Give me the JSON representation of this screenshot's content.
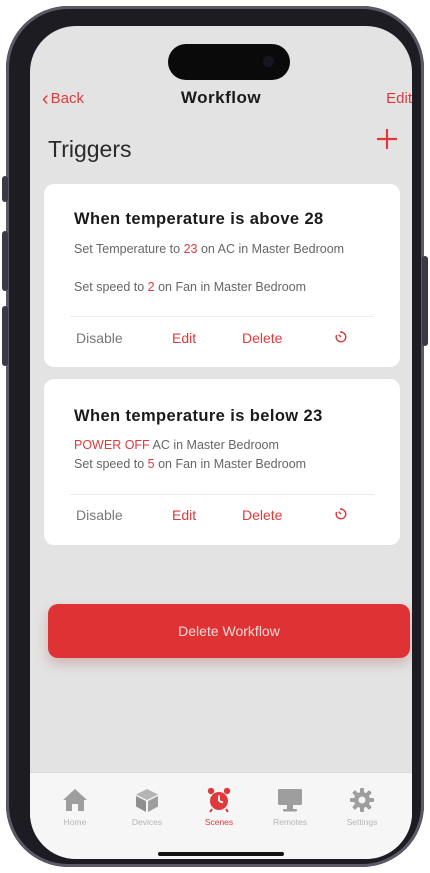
{
  "nav": {
    "back_label": "Back",
    "title": "Workflow",
    "edit_label": "Edit"
  },
  "triggers": {
    "heading": "Triggers",
    "add_icon": "plus-icon"
  },
  "cards": [
    {
      "title": "When temperature is above 28",
      "lines": [
        {
          "pre": "Set Temperature to ",
          "value": "23",
          "post": " on AC in Master Bedroom"
        },
        {
          "pre": "Set speed to ",
          "value": "2",
          "post": " on Fan in Master Bedroom"
        }
      ],
      "actions": {
        "disable": "Disable",
        "edit": "Edit",
        "delete": "Delete",
        "timer_icon": "timer-icon"
      }
    },
    {
      "title": "When temperature is below 23",
      "lines": [
        {
          "pre": "",
          "value": "POWER OFF",
          "post": " AC in Master Bedroom"
        },
        {
          "pre": "Set speed to ",
          "value": "5",
          "post": " on Fan in Master Bedroom"
        }
      ],
      "actions": {
        "disable": "Disable",
        "edit": "Edit",
        "delete": "Delete",
        "timer_icon": "timer-icon"
      }
    }
  ],
  "delete_workflow_label": "Delete Workflow",
  "tabs": [
    {
      "label": "Home",
      "icon": "home-icon",
      "active": false
    },
    {
      "label": "Devices",
      "icon": "cube-icon",
      "active": false
    },
    {
      "label": "Scenes",
      "icon": "alarm-clock-icon",
      "active": true
    },
    {
      "label": "Remotes",
      "icon": "monitor-icon",
      "active": false
    },
    {
      "label": "Settings",
      "icon": "gear-icon",
      "active": false
    }
  ],
  "colors": {
    "accent": "#e0393c",
    "background": "#e3e3e3",
    "card": "#ffffff",
    "tab_inactive": "#b5b5b5"
  }
}
